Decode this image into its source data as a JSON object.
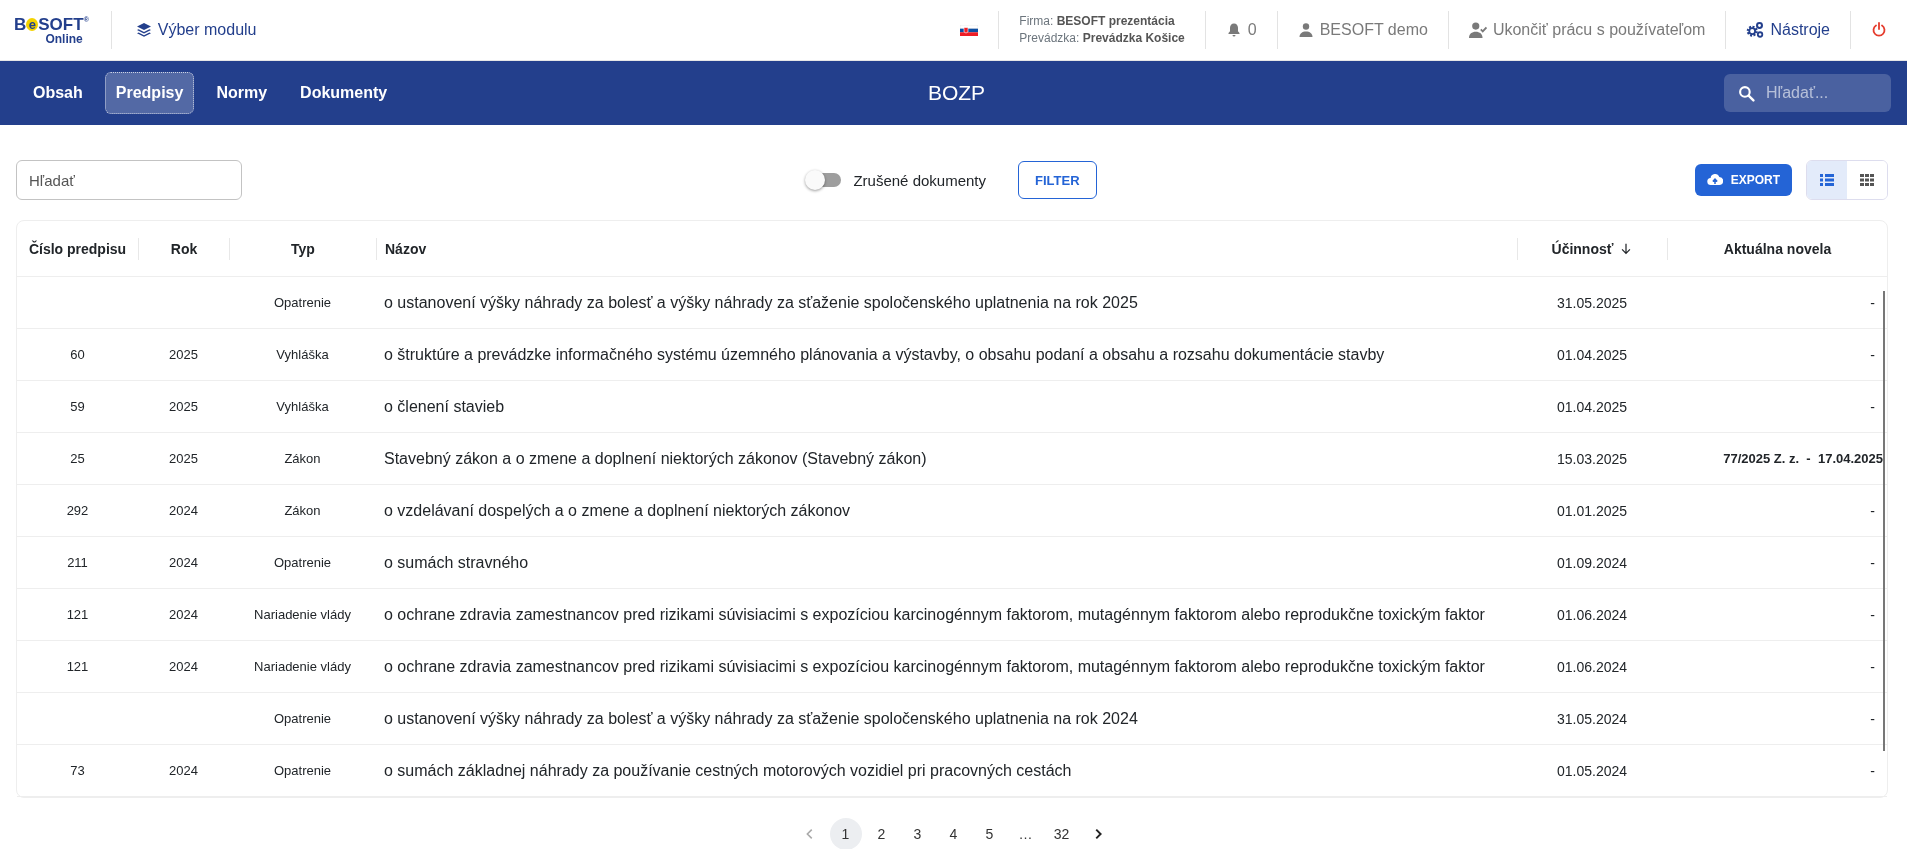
{
  "header": {
    "logo": {
      "parts": [
        "B",
        "e",
        "SOFT",
        "®"
      ],
      "sub": "Online"
    },
    "module_button": "Výber modulu",
    "firm_label": "Firma:",
    "firm": "BESOFT prezentácia",
    "branch_label": "Prevádzka:",
    "branch": "Prevádzka Košice",
    "notifications": "0",
    "user": "BESOFT demo",
    "end_session": "Ukončiť prácu s používateľom",
    "tools": "Nástroje"
  },
  "nav": {
    "tabs": [
      {
        "label": "Obsah",
        "selected": false
      },
      {
        "label": "Predpisy",
        "selected": true
      },
      {
        "label": "Normy",
        "selected": false
      },
      {
        "label": "Dokumenty",
        "selected": false
      }
    ],
    "title": "BOZP",
    "search": {
      "placeholder": "Hľadať..."
    }
  },
  "toolbar": {
    "search": {
      "placeholder": "Hľadať"
    },
    "cancelled_toggle": {
      "label": "Zrušené dokumenty",
      "on": false
    },
    "filter_button": "FILTER",
    "export_button": "EXPORT",
    "views": [
      {
        "kind": "list",
        "selected": true
      },
      {
        "kind": "grid",
        "selected": false
      }
    ]
  },
  "table": {
    "columns": [
      {
        "label": "Číslo predpisu",
        "sorted": false
      },
      {
        "label": "Rok",
        "sorted": false
      },
      {
        "label": "Typ",
        "sorted": false
      },
      {
        "label": "Názov",
        "sorted": false
      },
      {
        "label": "Účinnosť",
        "sorted": true
      },
      {
        "label": "Aktuálna novela",
        "sorted": false
      }
    ],
    "rows": [
      {
        "number": "",
        "year": "",
        "type": "Opatrenie",
        "name": "o ustanovení výšky náhrady za bolesť a výšky náhrady za sťaženie spoločenského uplatnenia na rok 2025",
        "effective": "31.05.2025",
        "amendment": "-",
        "amendment_emphasized": false
      },
      {
        "number": "60",
        "year": "2025",
        "type": "Vyhláška",
        "name": "o štruktúre a prevádzke informačného systému územného plánovania a výstavby, o obsahu podaní a obsahu a rozsahu dokumentácie stavby",
        "effective": "01.04.2025",
        "amendment": "-",
        "amendment_emphasized": false
      },
      {
        "number": "59",
        "year": "2025",
        "type": "Vyhláška",
        "name": "o členení stavieb",
        "effective": "01.04.2025",
        "amendment": "-",
        "amendment_emphasized": false
      },
      {
        "number": "25",
        "year": "2025",
        "type": "Zákon",
        "name": "Stavebný zákon a o zmene a doplnení niektorých zákonov (Stavebný zákon)",
        "effective": "15.03.2025",
        "amendment": "77/2025 Z. z.  -  17.04.2025",
        "amendment_emphasized": true
      },
      {
        "number": "292",
        "year": "2024",
        "type": "Zákon",
        "name": "o vzdelávaní dospelých a o zmene a doplnení niektorých zákonov",
        "effective": "01.01.2025",
        "amendment": "-",
        "amendment_emphasized": false
      },
      {
        "number": "211",
        "year": "2024",
        "type": "Opatrenie",
        "name": "o sumách stravného",
        "effective": "01.09.2024",
        "amendment": "-",
        "amendment_emphasized": false
      },
      {
        "number": "121",
        "year": "2024",
        "type": "Nariadenie vlády",
        "name": "o ochrane zdravia zamestnancov pred rizikami súvisiacimi s expozíciou karcinogénnym faktorom, mutagénnym faktorom alebo reprodukčne toxickým faktor",
        "effective": "01.06.2024",
        "amendment": "-",
        "amendment_emphasized": false
      },
      {
        "number": "121",
        "year": "2024",
        "type": "Nariadenie vlády",
        "name": "o ochrane zdravia zamestnancov pred rizikami súvisiacimi s expozíciou karcinogénnym faktorom, mutagénnym faktorom alebo reprodukčne toxickým faktor",
        "effective": "01.06.2024",
        "amendment": "-",
        "amendment_emphasized": false
      },
      {
        "number": "",
        "year": "",
        "type": "Opatrenie",
        "name": "o ustanovení výšky náhrady za bolesť a výšky náhrady za sťaženie spoločenského uplatnenia na rok 2024",
        "effective": "31.05.2024",
        "amendment": "-",
        "amendment_emphasized": false
      },
      {
        "number": "73",
        "year": "2024",
        "type": "Opatrenie",
        "name": "o sumách základnej náhrady za používanie cestných motorových vozidiel pri pracovných cestách",
        "effective": "01.05.2024",
        "amendment": "-",
        "amendment_emphasized": false
      }
    ]
  },
  "pagination": {
    "pages": [
      {
        "label": "1",
        "selected": true
      },
      {
        "label": "2",
        "selected": false
      },
      {
        "label": "3",
        "selected": false
      },
      {
        "label": "4",
        "selected": false
      },
      {
        "label": "5",
        "selected": false
      },
      {
        "label": "…",
        "selected": false
      },
      {
        "label": "32",
        "selected": false
      }
    ]
  }
}
